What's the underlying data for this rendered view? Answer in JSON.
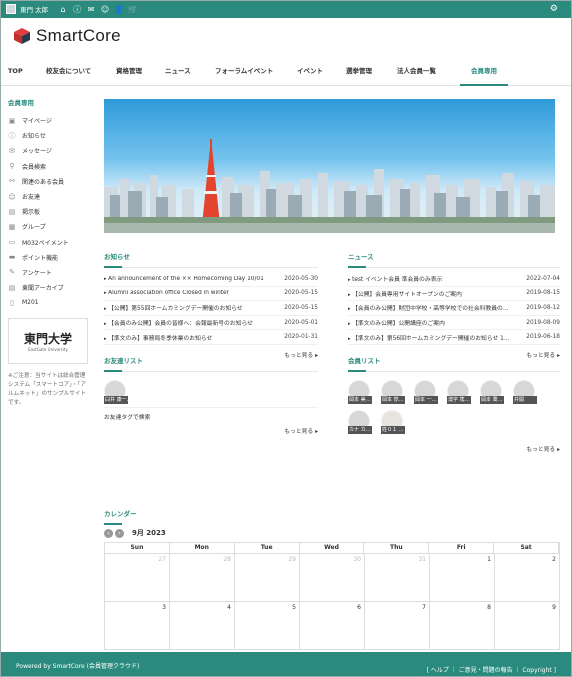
{
  "topbar": {
    "user_name": "東門 太郎"
  },
  "logo": {
    "text": "SmartCore"
  },
  "nav": {
    "items": [
      {
        "label": "TOP",
        "active": false
      },
      {
        "label": "校友会について",
        "active": false
      },
      {
        "label": "資格管理",
        "active": false
      },
      {
        "label": "ニュース",
        "active": false
      },
      {
        "label": "フォーラムイベント",
        "active": false
      },
      {
        "label": "イベント",
        "active": false
      },
      {
        "label": "選挙管理",
        "active": false
      },
      {
        "label": "法人会員一覧",
        "active": false
      },
      {
        "label": "会員専用",
        "active": true
      }
    ]
  },
  "sidebar": {
    "title": "会員専用",
    "items": [
      {
        "label": "マイページ",
        "icon": "mypage-icon"
      },
      {
        "label": "お知らせ",
        "icon": "info-icon"
      },
      {
        "label": "メッセージ",
        "icon": "mail-icon"
      },
      {
        "label": "会員検索",
        "icon": "search-icon"
      },
      {
        "label": "関連のある会員",
        "icon": "link-icon"
      },
      {
        "label": "お友達",
        "icon": "friend-icon"
      },
      {
        "label": "掲示板",
        "icon": "board-icon"
      },
      {
        "label": "グループ",
        "icon": "group-icon"
      },
      {
        "label": "M032ペイメント",
        "icon": "payment-icon"
      },
      {
        "label": "ポイント機能",
        "icon": "point-icon"
      },
      {
        "label": "アンケート",
        "icon": "survey-icon"
      },
      {
        "label": "東聞アーカイブ",
        "icon": "archive-icon"
      },
      {
        "label": "M201",
        "icon": "doc-icon"
      }
    ],
    "univ_logo": {
      "kanji": "東門大学",
      "english": "EastGate University"
    },
    "note": "※ご注意：当サイトは総合管理システム「スマートコア」・「アルムネット」のサンプルサイトです。"
  },
  "oshirase": {
    "title": "お知らせ",
    "rows": [
      {
        "text": "An announcement of the ×× Homecoming Day 10/01",
        "date": "2020-05-30"
      },
      {
        "text": "Alumni association office Closed in winter",
        "date": "2020-05-15"
      },
      {
        "text": "【公開】第55回ホームカミングデー開催のお知らせ",
        "date": "2020-05-15"
      },
      {
        "text": "【会員のみ公開】会員の皆様へ：会報最新号のお知らせ",
        "date": "2020-05-01"
      },
      {
        "text": "【準文のみ】事務局冬季休業のお知らせ",
        "date": "2020-01-31"
      }
    ],
    "more": "もっと見る"
  },
  "news": {
    "title": "ニュース",
    "rows": [
      {
        "text": "test イベント会員 準会員のみ表示",
        "date": "2022-07-04"
      },
      {
        "text": "【公開】会員専用サイトオープンのご案内",
        "date": "2019-08-15"
      },
      {
        "text": "【会員のみ公開】財団中学校・高等学校での社会科教員の…",
        "date": "2019-08-12"
      },
      {
        "text": "【準文のみ公開】公開講座のご案内",
        "date": "2019-08-09"
      },
      {
        "text": "【準文のみ】第56回ホームカミングデー開催のお知らせ 1…",
        "date": "2019-06-18"
      }
    ],
    "more": "もっと見る"
  },
  "friends": {
    "title": "お友達リスト",
    "people": [
      "臼井 康一…"
    ],
    "tag_search": "お友達タグで検索",
    "more": "もっと見る"
  },
  "members": {
    "title": "会員リスト",
    "people": [
      "岡本 美…",
      "岡本 惇…",
      "岡本 一…",
      "澳字 篤…",
      "岡本 喬…",
      "井開",
      "カナ カ…",
      "姓０１ …"
    ],
    "more": "もっと見る"
  },
  "calendar": {
    "title": "カレンダー",
    "month": "9月 2023",
    "weekdays": [
      "Sun",
      "Mon",
      "Tue",
      "Wed",
      "Thu",
      "Fri",
      "Sat"
    ],
    "week1": [
      "27",
      "28",
      "29",
      "30",
      "31",
      "1",
      "2"
    ],
    "week2": [
      "3",
      "4",
      "5",
      "6",
      "7",
      "8",
      "9"
    ]
  },
  "footer": {
    "powered": "Powered by SmartCore (会員管理クラウド)",
    "links": "[ ヘルプ ｜ ご意見・問題の報告 ｜ Copyright ]"
  },
  "colors": {
    "accent": "#2a8a7d",
    "logo_red": "#e03c3c",
    "logo_dark": "#2b3a4a"
  }
}
